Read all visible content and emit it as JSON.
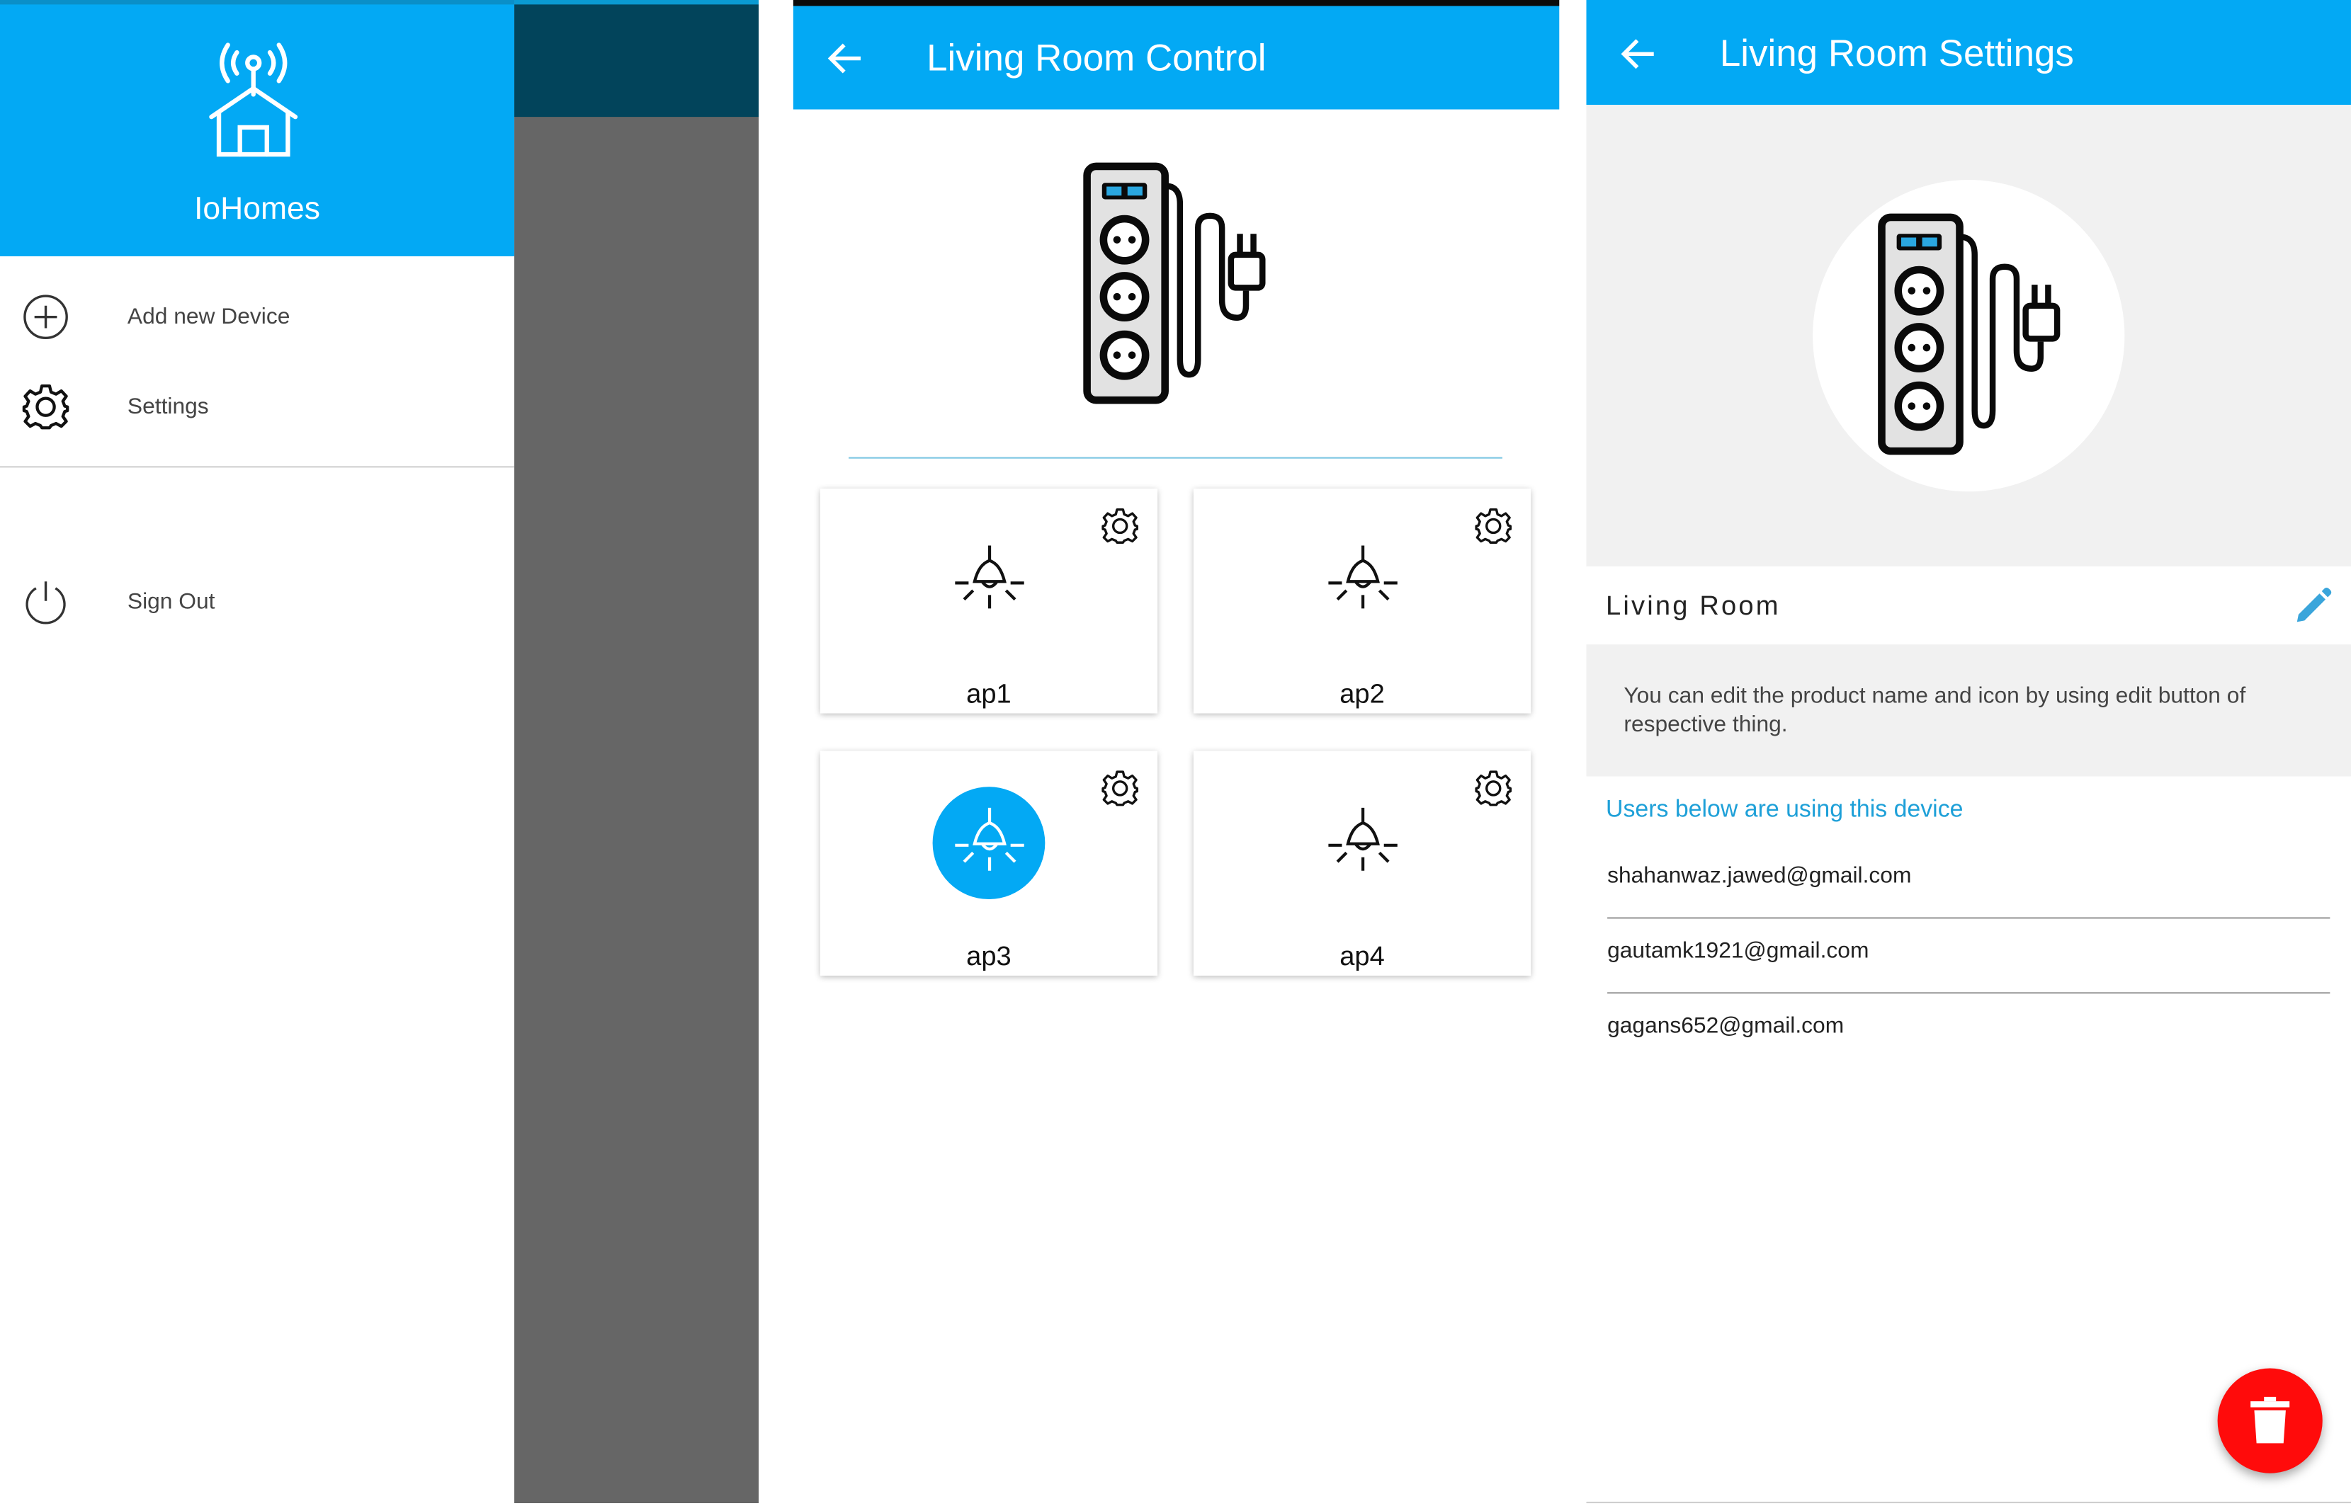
{
  "colors": {
    "primary": "#03a9f4",
    "scrim": "#666666",
    "danger": "#ff0b0b"
  },
  "drawer": {
    "app_name": "IoHomes",
    "logo_icon": "smart-home-antenna-icon",
    "items": [
      {
        "label": "Add new Device",
        "icon": "plus-circle-icon"
      },
      {
        "label": "Settings",
        "icon": "gear-icon"
      },
      {
        "label": "Sign Out",
        "icon": "power-icon"
      }
    ]
  },
  "control": {
    "title": "Living Room Control",
    "device_icon": "power-strip-icon",
    "appliances": [
      {
        "name": "ap1",
        "on": false,
        "icon": "ceiling-lamp-icon"
      },
      {
        "name": "ap2",
        "on": false,
        "icon": "ceiling-lamp-icon"
      },
      {
        "name": "ap3",
        "on": true,
        "icon": "ceiling-lamp-icon"
      },
      {
        "name": "ap4",
        "on": false,
        "icon": "ceiling-lamp-icon"
      }
    ]
  },
  "settings": {
    "title": "Living Room Settings",
    "device_name": "Living Room",
    "info": "You can edit the product name and icon by using edit button of respective thing.",
    "users_heading": "Users below are using this device",
    "users": [
      "shahanwaz.jawed@gmail.com",
      "gautamk1921@gmail.com",
      "gagans652@gmail.com"
    ],
    "delete_icon": "trash-icon"
  }
}
